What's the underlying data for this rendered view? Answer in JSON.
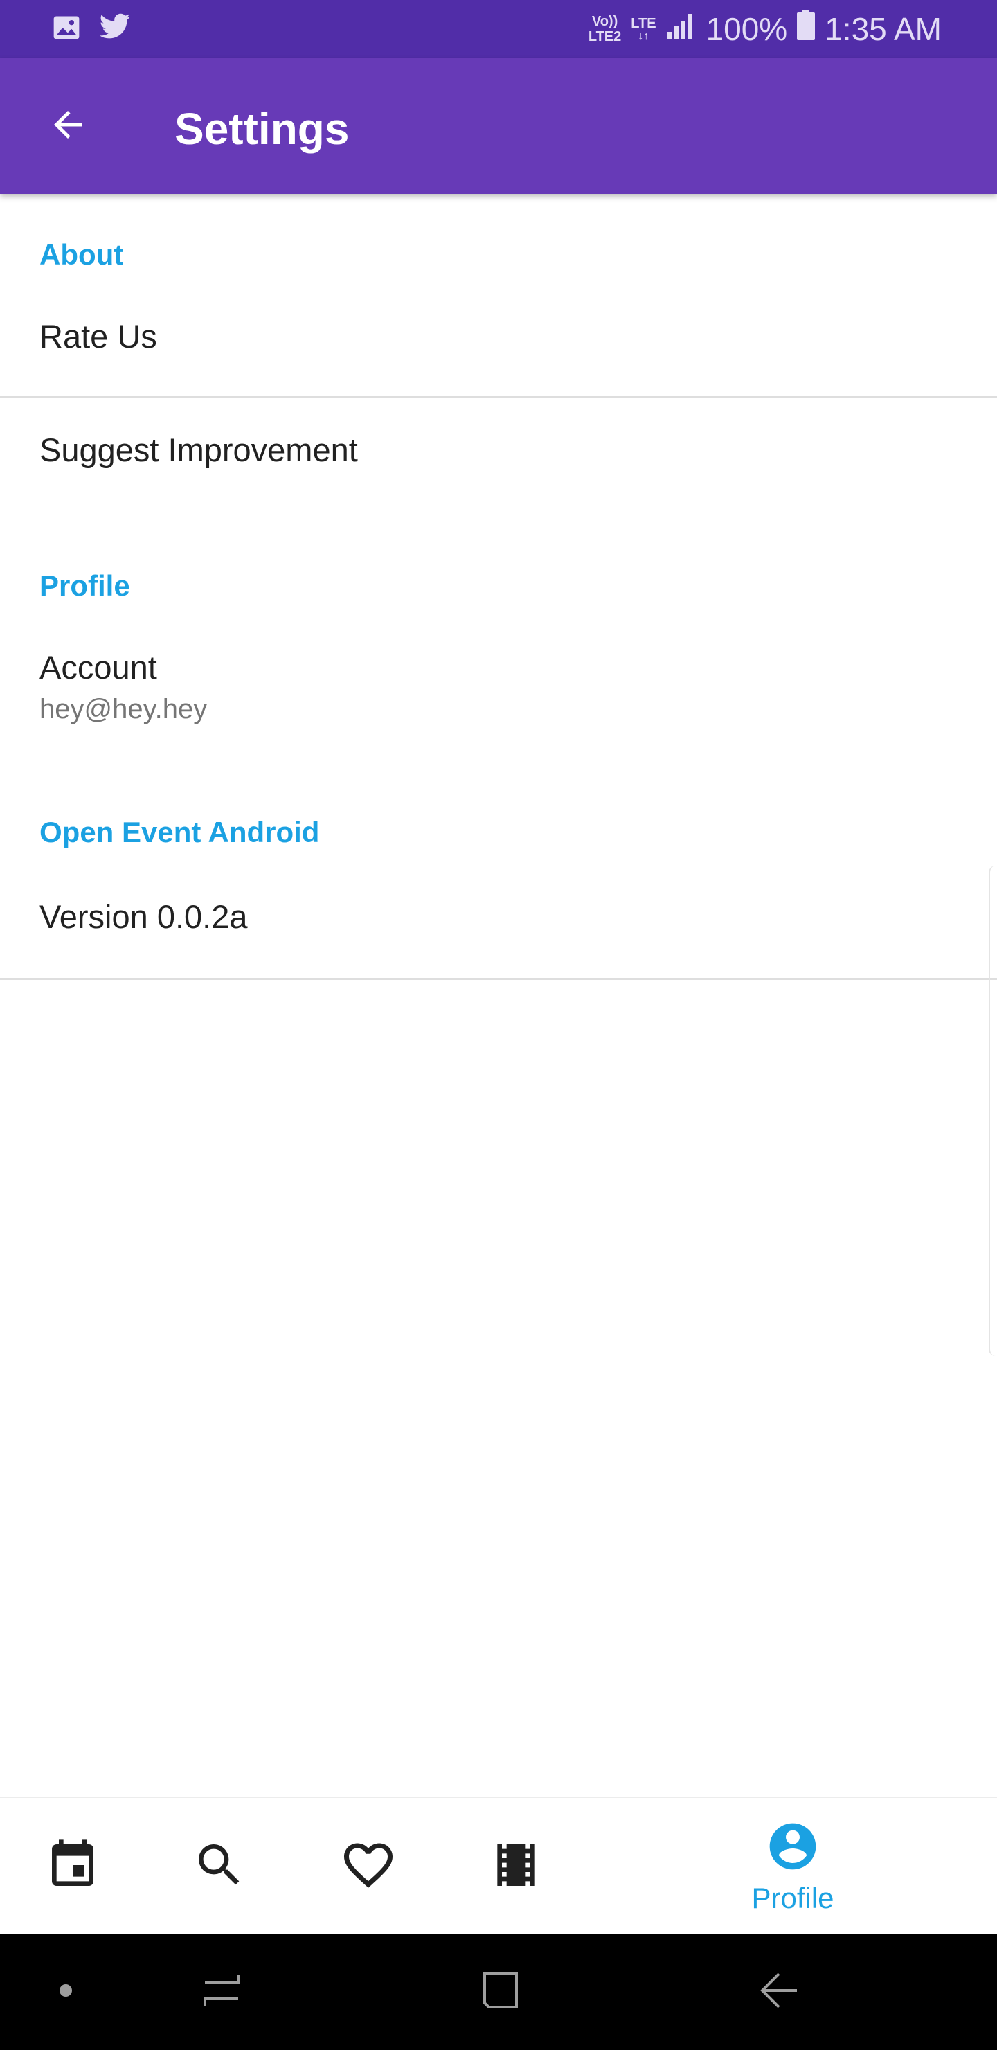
{
  "status_bar": {
    "net_top": "Vo))",
    "net_bottom": "LTE2",
    "lte": "LTE",
    "battery": "100%",
    "time": "1:35 AM",
    "icons": [
      "image-icon",
      "twitter-icon",
      "signal-icon",
      "battery-icon"
    ]
  },
  "app_bar": {
    "title": "Settings",
    "back_icon": "arrow-back-icon"
  },
  "sections": {
    "about": {
      "header": "About",
      "rate_us": "Rate Us",
      "suggest": "Suggest Improvement"
    },
    "profile": {
      "header": "Profile",
      "account_title": "Account",
      "account_summary": "hey@hey.hey"
    },
    "app": {
      "header": "Open Event Android",
      "version": "Version 0.0.2a"
    }
  },
  "bottom_nav": {
    "items": [
      {
        "icon": "calendar-icon"
      },
      {
        "icon": "search-icon"
      },
      {
        "icon": "heart-icon"
      },
      {
        "icon": "film-icon"
      },
      {
        "icon": "account-circle-icon",
        "label": "Profile",
        "active": true
      }
    ]
  },
  "system_nav": {
    "icons": [
      "home-dot-icon",
      "recents-icon",
      "home-square-icon",
      "back-icon"
    ]
  },
  "colors": {
    "status_bar": "#512da8",
    "app_bar": "#673ab7",
    "accent": "#1ba1e2",
    "primary_text": "#212121",
    "secondary_text": "#757575"
  }
}
